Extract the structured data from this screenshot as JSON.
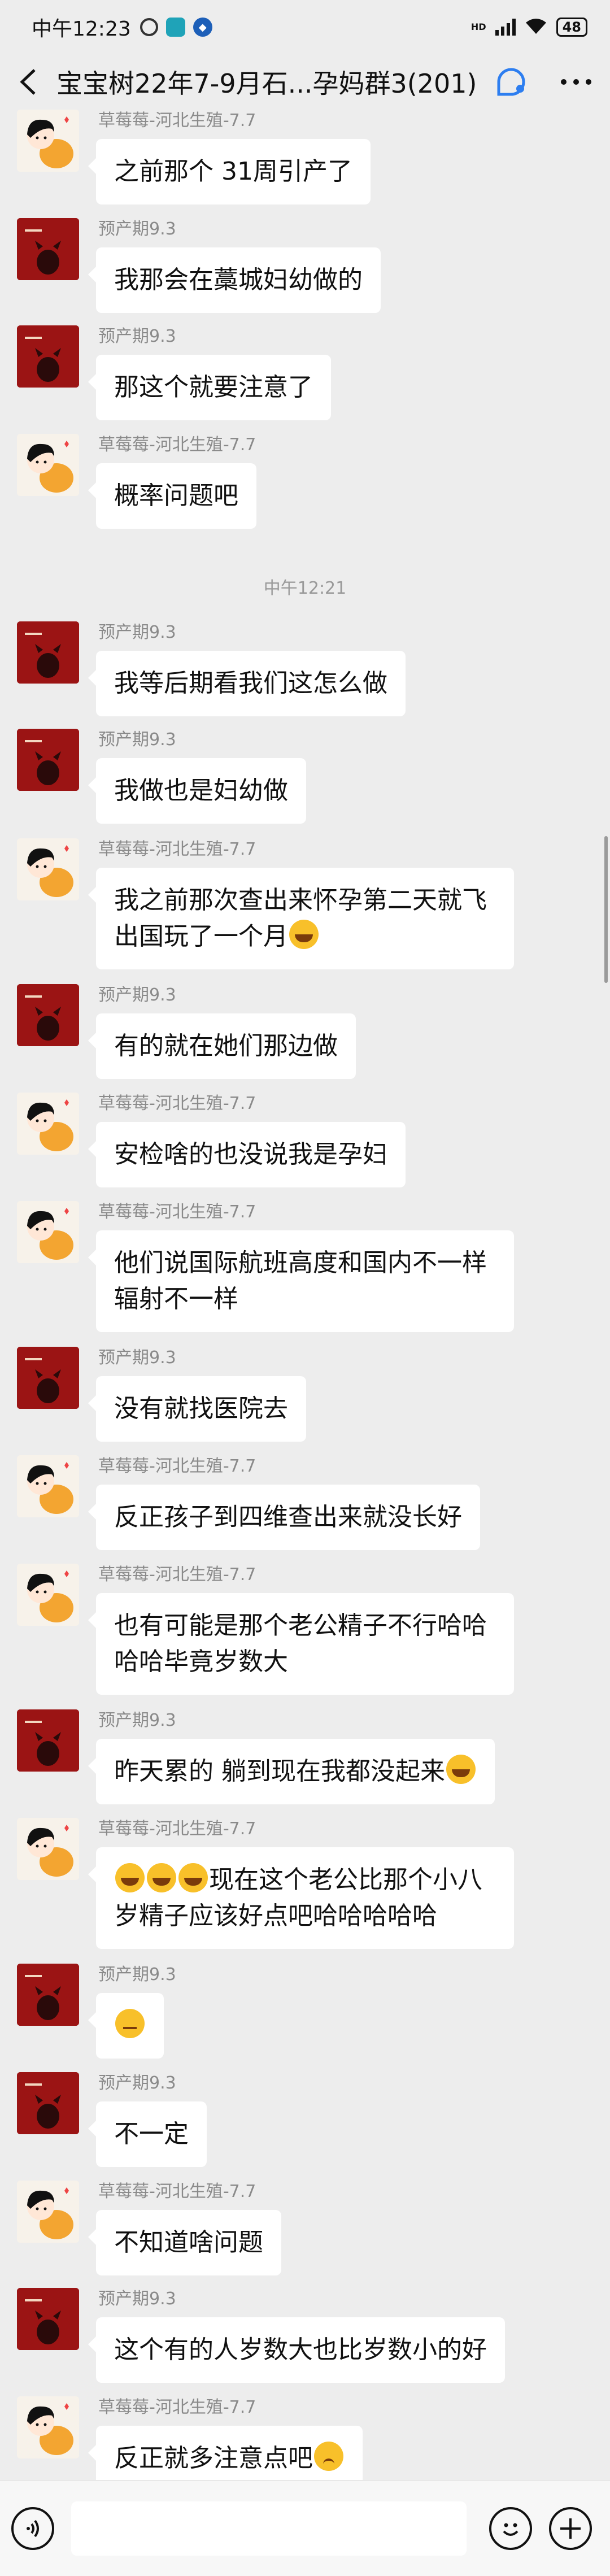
{
  "status_bar": {
    "time": "中午12:23",
    "battery": "48",
    "network": "HD"
  },
  "header": {
    "title": "宝宝树22年7-9月石...孕妈群3(201)"
  },
  "messages": [
    {
      "sender": "草莓莓-河北生殖-7.7",
      "avatar": "girl",
      "text": "之前那个 31周引产了"
    },
    {
      "sender": "预产期9.3",
      "avatar": "red",
      "text": "我那会在藁城妇幼做的"
    },
    {
      "sender": "预产期9.3",
      "avatar": "red",
      "text": "那这个就要注意了"
    },
    {
      "sender": "草莓莓-河北生殖-7.7",
      "avatar": "girl",
      "text": "概率问题吧"
    },
    {
      "sender": "预产期9.3",
      "avatar": "red",
      "text": "我等后期看我们这怎么做"
    },
    {
      "sender": "预产期9.3",
      "avatar": "red",
      "text": "我做也是妇幼做"
    },
    {
      "sender": "草莓莓-河北生殖-7.7",
      "avatar": "girl",
      "text": "我之前那次查出来怀孕第二天就飞出国玩了一个月",
      "emoji": "laugh"
    },
    {
      "sender": "预产期9.3",
      "avatar": "red",
      "text": "有的就在她们那边做"
    },
    {
      "sender": "草莓莓-河北生殖-7.7",
      "avatar": "girl",
      "text": "安检啥的也没说我是孕妇"
    },
    {
      "sender": "草莓莓-河北生殖-7.7",
      "avatar": "girl",
      "text": "他们说国际航班高度和国内不一样辐射不一样"
    },
    {
      "sender": "预产期9.3",
      "avatar": "red",
      "text": "没有就找医院去"
    },
    {
      "sender": "草莓莓-河北生殖-7.7",
      "avatar": "girl",
      "text": "反正孩子到四维查出来就没长好"
    },
    {
      "sender": "草莓莓-河北生殖-7.7",
      "avatar": "girl",
      "text": "也有可能是那个老公精子不行哈哈哈哈毕竟岁数大"
    },
    {
      "sender": "预产期9.3",
      "avatar": "red",
      "text": "昨天累的 躺到现在我都没起来",
      "emoji": "laugh"
    },
    {
      "sender": "草莓莓-河北生殖-7.7",
      "avatar": "girl",
      "text": "现在这个老公比那个小八岁精子应该好点吧哈哈哈哈哈",
      "lead_emoji": "laugh-x3"
    },
    {
      "sender": "预产期9.3",
      "avatar": "red",
      "text": "",
      "emoji": "meh"
    },
    {
      "sender": "预产期9.3",
      "avatar": "red",
      "text": "不一定"
    },
    {
      "sender": "草莓莓-河北生殖-7.7",
      "avatar": "girl",
      "text": "不知道啥问题"
    },
    {
      "sender": "预产期9.3",
      "avatar": "red",
      "text": "这个有的人岁数大也比岁数小的好"
    },
    {
      "sender": "草莓莓-河北生殖-7.7",
      "avatar": "girl",
      "text": "反正就多注意点吧",
      "emoji": "sad"
    }
  ],
  "time_divider": "中午12:21",
  "input_bar": {
    "placeholder": ""
  }
}
